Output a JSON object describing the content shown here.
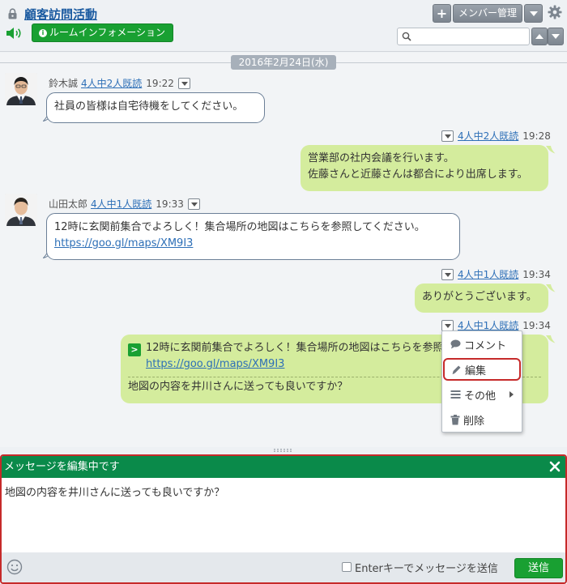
{
  "header": {
    "room_title": "顧客訪問活動",
    "room_info_label": "ルームインフォメーション",
    "add_label": "+",
    "member_label": "メンバー管理",
    "search_placeholder": ""
  },
  "timeline": {
    "date": "2016年2月24日(水)",
    "messages": [
      {
        "sender": "鈴木誠",
        "read": "4人中2人既読",
        "time": "19:22",
        "lines": [
          "社員の皆様は自宅待機をしてください。"
        ]
      },
      {
        "read": "4人中2人既読",
        "time": "19:28",
        "lines": [
          "営業部の社内会議を行います。",
          "佐藤さんと近藤さんは都合により出席します。"
        ]
      },
      {
        "sender": "山田太郎",
        "read": "4人中1人既読",
        "time": "19:33",
        "lines": [
          "12時に玄関前集合でよろしく！集合場所の地図はこちらを参照してください。"
        ],
        "link": "https://goo.gl/maps/XM9I3"
      },
      {
        "read": "4人中1人既読",
        "time": "19:34",
        "lines": [
          "ありがとうございます。"
        ]
      },
      {
        "read": "4人中1人既読",
        "time": "19:34",
        "quote_tag": ">",
        "quote_text": "12時に玄関前集合でよろしく！集合場所の地図はこちらを参照してください。",
        "quote_link": "https://goo.gl/maps/XM9I3",
        "reply": "地図の内容を井川さんに送っても良いですか？"
      }
    ]
  },
  "context_menu": {
    "comment": "コメント",
    "edit": "編集",
    "other": "その他",
    "delete": "削除"
  },
  "editor": {
    "title": "メッセージを編集中です",
    "text": "地図の内容を井川さんに送っても良いですか？",
    "enter_label": "Enterキーでメッセージを送信",
    "send_label": "送信"
  },
  "colors": {
    "accent_green": "#19a032",
    "header_green": "#0a8a4a",
    "bubble_out": "#d4ec9d",
    "link": "#2d6fb7",
    "highlight_red": "#c62a2a"
  }
}
